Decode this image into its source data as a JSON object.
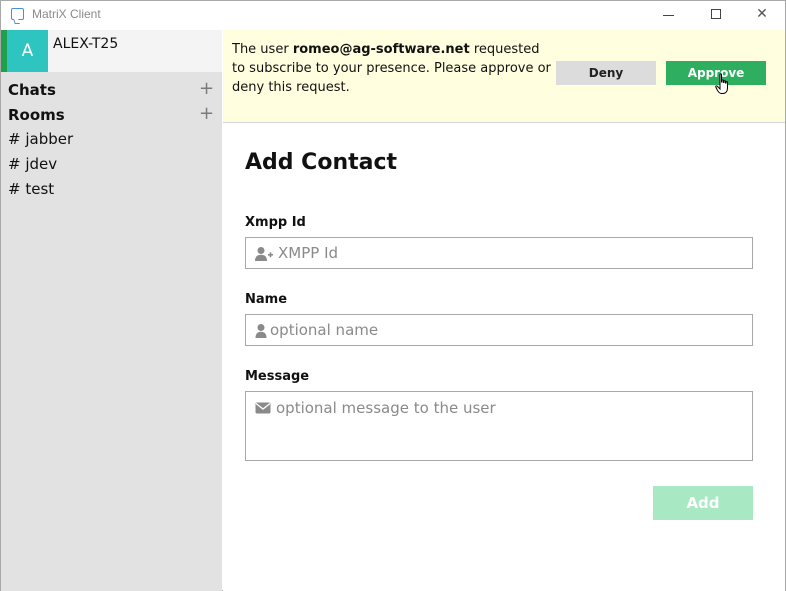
{
  "window": {
    "title": "MatriX Client",
    "minimize_icon": "minimize-icon",
    "maximize_icon": "maximize-icon",
    "close_icon": "close-icon",
    "close_glyph": "✕"
  },
  "sidebar": {
    "account": {
      "avatar_letter": "A",
      "name": "ALEX-T25",
      "avatar_color": "#2ec4c0",
      "status_color": "#1fa04a"
    },
    "sections": [
      {
        "label": "Chats",
        "add_glyph": "+"
      },
      {
        "label": "Rooms",
        "add_glyph": "+"
      }
    ],
    "rooms": [
      {
        "label": "# jabber"
      },
      {
        "label": "# jdev"
      },
      {
        "label": "# test"
      }
    ]
  },
  "notice": {
    "text_before": "The user ",
    "user": "romeo@ag-software.net",
    "text_after": " requested to subscribe to your presence. Please approve or deny this request.",
    "deny_label": "Deny",
    "approve_label": "Approve",
    "background": "#ffffe0",
    "approve_color": "#2eae5f"
  },
  "form": {
    "title": "Add Contact",
    "xmpp": {
      "label": "Xmpp Id",
      "placeholder": "XMPP Id",
      "value": "",
      "icon": "user-plus-icon"
    },
    "name": {
      "label": "Name",
      "placeholder": "optional name",
      "value": "",
      "icon": "user-icon"
    },
    "message": {
      "label": "Message",
      "placeholder": "optional message to the user",
      "value": "",
      "icon": "envelope-icon"
    },
    "add_label": "Add",
    "add_color": "#a8e9c4"
  }
}
